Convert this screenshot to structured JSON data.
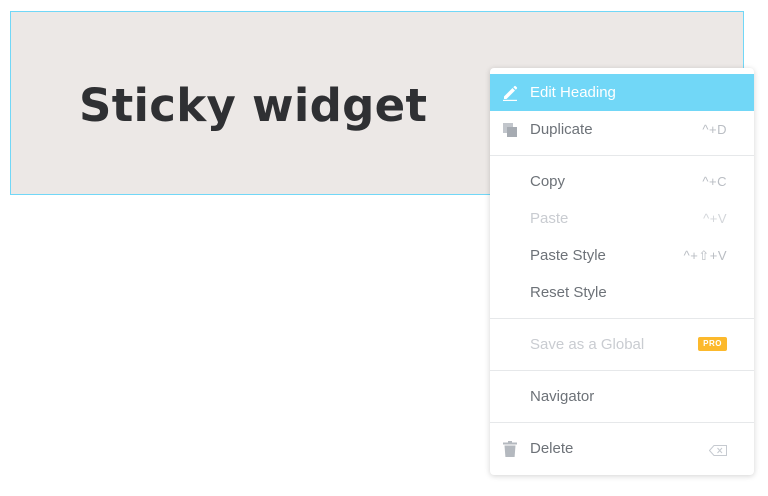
{
  "widget": {
    "heading": "Sticky widget"
  },
  "context_menu": {
    "items": [
      {
        "label": "Edit Heading",
        "shortcut": "",
        "icon": "pencil-icon",
        "state": "active"
      },
      {
        "label": "Duplicate",
        "shortcut": "^+D",
        "icon": "duplicate-icon",
        "state": "normal"
      },
      {
        "label": "Copy",
        "shortcut": "^+C",
        "icon": "",
        "state": "normal"
      },
      {
        "label": "Paste",
        "shortcut": "^+V",
        "icon": "",
        "state": "disabled"
      },
      {
        "label": "Paste Style",
        "shortcut": "^+⇧+V",
        "icon": "",
        "state": "normal"
      },
      {
        "label": "Reset Style",
        "shortcut": "",
        "icon": "",
        "state": "normal"
      },
      {
        "label": "Save as a Global",
        "badge": "PRO",
        "icon": "",
        "state": "disabled"
      },
      {
        "label": "Navigator",
        "shortcut": "",
        "icon": "",
        "state": "normal"
      },
      {
        "label": "Delete",
        "shortcut_icon": "backspace-key-icon",
        "icon": "trash-icon",
        "state": "normal"
      }
    ]
  },
  "colors": {
    "accent": "#71d7f7",
    "widget_background": "#ece8e6",
    "heading_text": "#2f3033",
    "menu_text": "#6d7278",
    "disabled_text": "#c9ccd1",
    "pro_badge": "#fcb92c"
  }
}
